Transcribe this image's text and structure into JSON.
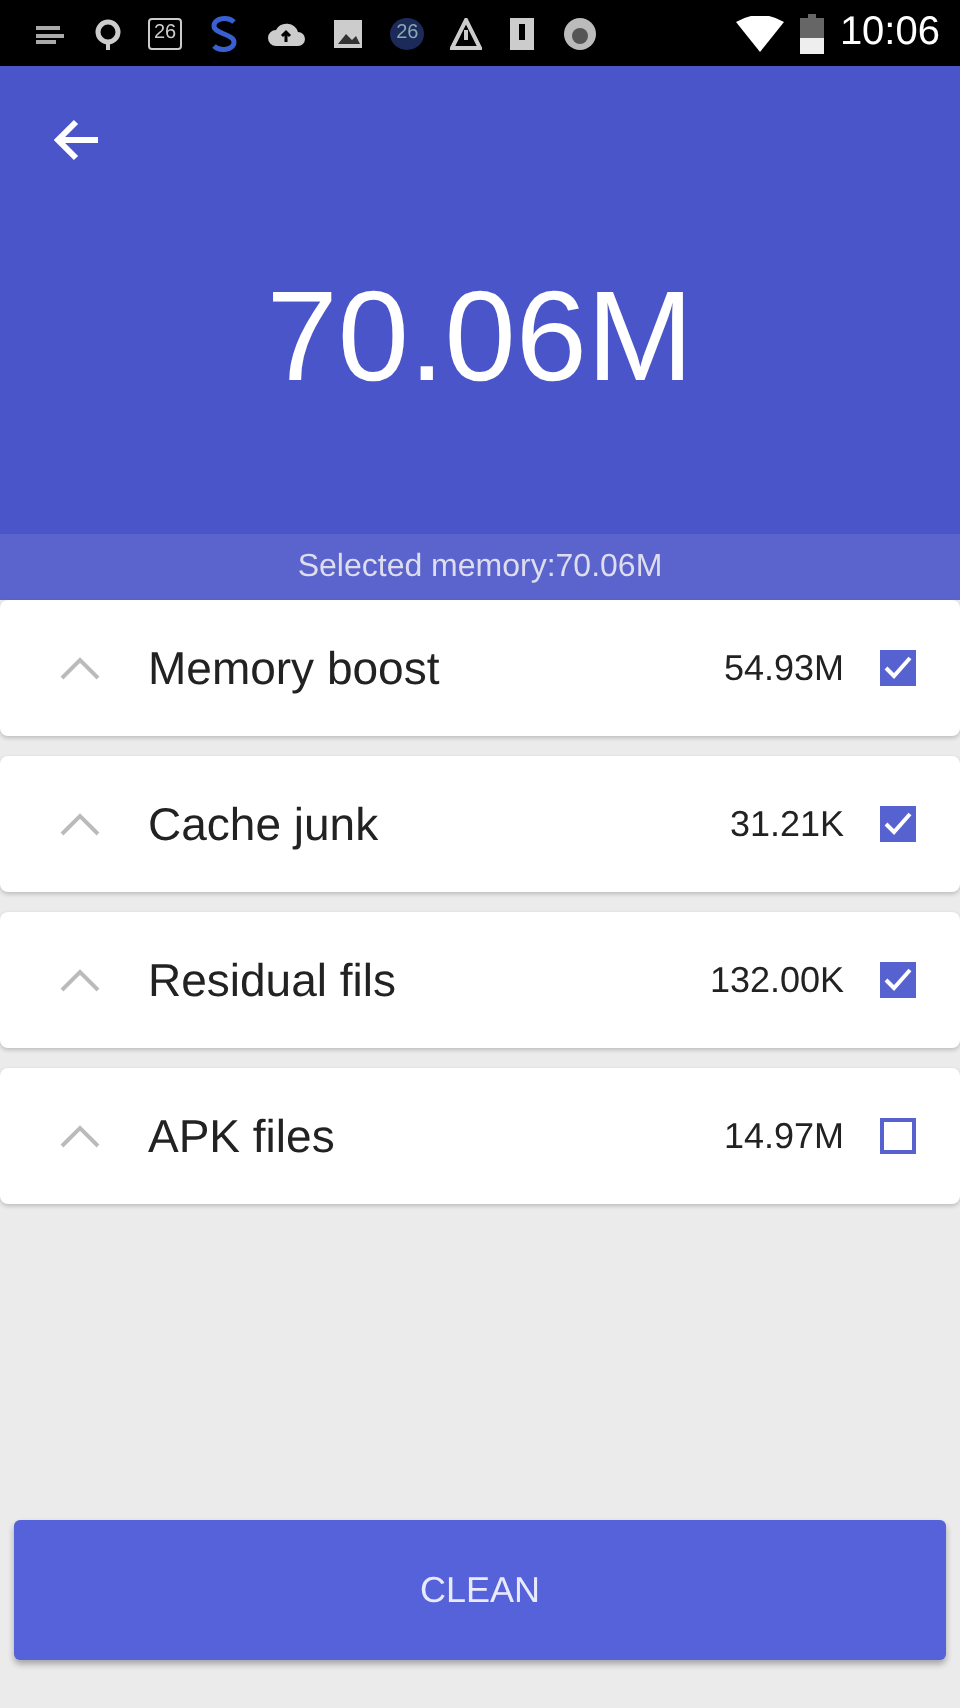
{
  "status_bar": {
    "badges": [
      "26",
      "26"
    ],
    "time": "10:06"
  },
  "header": {
    "total": "70.06M",
    "selected_label": "Selected memory:70.06M"
  },
  "items": [
    {
      "name": "Memory boost",
      "size": "54.93M",
      "checked": true
    },
    {
      "name": "Cache junk",
      "size": "31.21K",
      "checked": true
    },
    {
      "name": "Residual fils",
      "size": "132.00K",
      "checked": true
    },
    {
      "name": "APK files",
      "size": "14.97M",
      "checked": false
    }
  ],
  "button": "CLEAN"
}
